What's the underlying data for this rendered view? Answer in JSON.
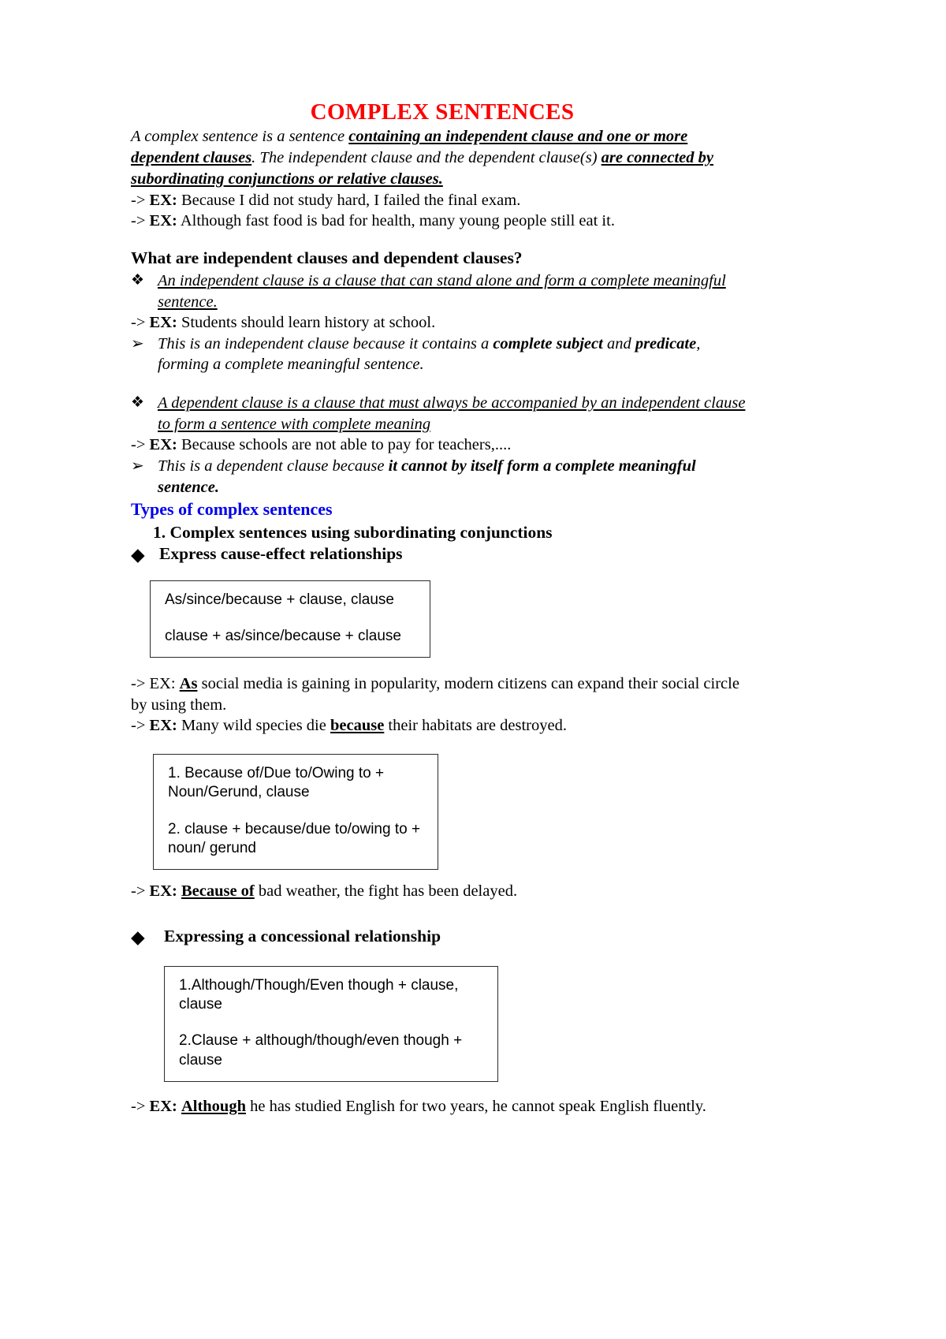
{
  "document": {
    "title": "COMPLEX SENTENCES",
    "title_color": "#ff0000",
    "blue_heading_color": "#0000ee"
  },
  "intro": {
    "part1": "A complex sentence is a sentence ",
    "emph1": "containing an independent clause and one or more dependent clauses",
    "part2": ". The independent clause and the dependent clause(s) ",
    "emph2": "are connected by subordinating conjunctions or relative clauses."
  },
  "intro_examples": [
    {
      "arrow": "-> ",
      "tag": "EX:",
      "text": " Because I did not study hard, I failed the final exam."
    },
    {
      "arrow": "-> ",
      "tag": "EX:",
      "text": " Although fast food is bad for health, many young people still eat it."
    }
  ],
  "clauses_section": {
    "heading": "What are independent clauses and dependent clauses?",
    "independent": {
      "bullet_glyph": "❖",
      "definition": "An independent clause is a clause that can stand alone and form a complete meaningful sentence.",
      "example": {
        "arrow": "-> ",
        "tag": "EX:",
        "text": " Students should learn history at school."
      },
      "note_glyph": "➢",
      "note_part1": "This is an independent clause because it contains a ",
      "note_emph1": "complete subject",
      "note_part2": " and ",
      "note_emph2": "predicate",
      "note_part3": ", forming a complete meaningful sentence."
    },
    "dependent": {
      "bullet_glyph": "❖",
      "definition": "A dependent clause is a clause that must always be accompanied by an independent clause to form a sentence with complete meaning",
      "example": {
        "arrow": "-> ",
        "tag": "EX:",
        "text": " Because schools are not able to pay for teachers,...."
      },
      "note_glyph": "➢",
      "note_part1": "This is a dependent clause because ",
      "note_emph1": "it cannot by itself form a complete meaningful sentence."
    }
  },
  "types_section": {
    "heading": "Types of complex sentences",
    "item1": "1. Complex sentences using subordinating conjunctions",
    "cause_effect": {
      "bullet_glyph": "◆",
      "heading": "Express cause-effect relationships",
      "box1": {
        "line1": "As/since/because + clause, clause",
        "line2": "clause + as/since/because + clause"
      },
      "example1": {
        "arrow": "-> ",
        "tag": "EX:",
        "pre": " ",
        "emph": "As",
        "text": " social media is gaining in popularity, modern citizens can expand their social circle by using them."
      },
      "example2": {
        "arrow": "-> ",
        "tag": "EX:",
        "pre": " Many wild species die ",
        "emph": "because",
        "text": " their habitats are destroyed."
      },
      "box2": {
        "line1": "1. Because of/Due to/Owing to + Noun/Gerund, clause",
        "line2": "2. clause + because/due to/owing to + noun/ gerund"
      },
      "example3": {
        "arrow": "-> ",
        "tag": "EX:",
        "pre": " ",
        "emph": "Because of",
        "text": " bad weather, the fight has been delayed."
      }
    },
    "concessional": {
      "bullet_glyph": "◆",
      "heading": "Expressing a concessional relationship",
      "box3": {
        "line1": "1.Although/Though/Even though + clause, clause",
        "line2": "2.Clause + although/though/even though + clause"
      },
      "example1": {
        "arrow": "-> ",
        "tag": "EX:",
        "pre": " ",
        "emph": "Although",
        "text": " he has studied English for two years, he cannot speak English fluently."
      }
    }
  }
}
